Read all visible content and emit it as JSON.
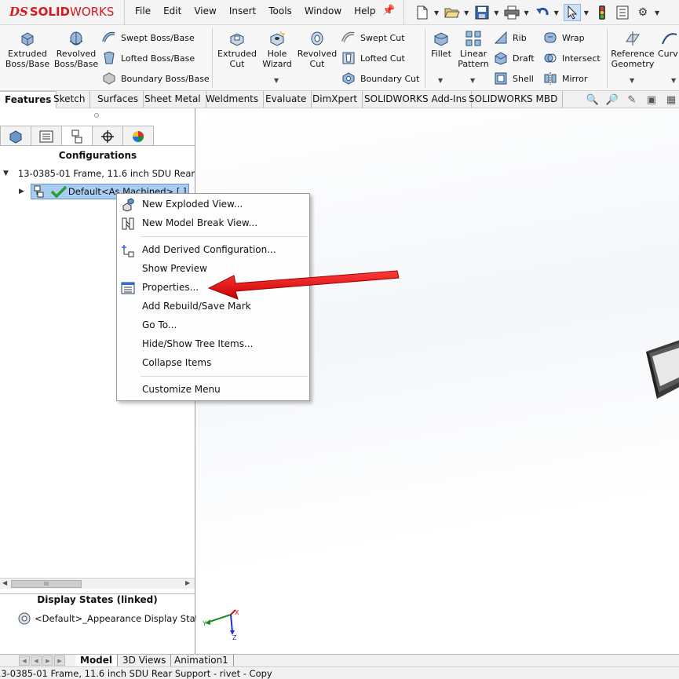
{
  "app": {
    "logo_prefix": "DS",
    "logo_brand_bold": "SOLID",
    "logo_brand_rest": "WORKS",
    "brand_color": "#d71920"
  },
  "menu": [
    "File",
    "Edit",
    "View",
    "Insert",
    "Tools",
    "Window",
    "Help"
  ],
  "ribbon": {
    "extruded_boss": "Extruded\nBoss/Base",
    "revolved_boss": "Revolved\nBoss/Base",
    "swept_boss": "Swept Boss/Base",
    "lofted_boss": "Lofted Boss/Base",
    "boundary_boss": "Boundary Boss/Base",
    "extruded_cut": "Extruded\nCut",
    "hole_wizard": "Hole\nWizard",
    "revolved_cut": "Revolved\nCut",
    "swept_cut": "Swept Cut",
    "lofted_cut": "Lofted Cut",
    "boundary_cut": "Boundary Cut",
    "fillet": "Fillet",
    "linear_pattern": "Linear\nPattern",
    "rib": "Rib",
    "draft": "Draft",
    "shell": "Shell",
    "wrap": "Wrap",
    "intersect": "Intersect",
    "mirror": "Mirror",
    "reference_geometry": "Reference\nGeometry",
    "curves": "Curv"
  },
  "command_tabs": [
    "Features",
    "Sketch",
    "Surfaces",
    "Sheet Metal",
    "Weldments",
    "Evaluate",
    "DimXpert",
    "SOLIDWORKS Add-Ins",
    "SOLIDWORKS MBD"
  ],
  "config_panel": {
    "header": "Configurations",
    "root_item": "13-0385-01 Frame, 11.6 inch SDU Rear",
    "child_item": "Default<As Machined> [ ]",
    "scroll_thumb": "III",
    "display_states_header": "Display States (linked)",
    "display_state_item": "<Default>_Appearance Display State"
  },
  "context_menu": {
    "items": [
      {
        "label": "New Exploded View...",
        "icon": "exploded-view-icon"
      },
      {
        "label": "New Model Break View...",
        "icon": "model-break-view-icon"
      },
      {
        "label": "Add Derived Configuration...",
        "icon": "derived-config-icon"
      },
      {
        "label": "Show Preview",
        "icon": ""
      },
      {
        "label": "Properties...",
        "icon": "properties-icon"
      },
      {
        "label": "Add Rebuild/Save Mark",
        "icon": ""
      },
      {
        "label": "Go To...",
        "icon": ""
      },
      {
        "label": "Hide/Show Tree Items...",
        "icon": ""
      },
      {
        "label": "Collapse Items",
        "icon": ""
      },
      {
        "label": "Customize Menu",
        "icon": ""
      }
    ]
  },
  "bottom_tabs": [
    "Model",
    "3D Views",
    "Animation1"
  ],
  "status": "13-0385-01 Frame, 11.6 inch SDU Rear Support - rivet - Copy",
  "annotation": {
    "arrow_color": "#e01010"
  }
}
